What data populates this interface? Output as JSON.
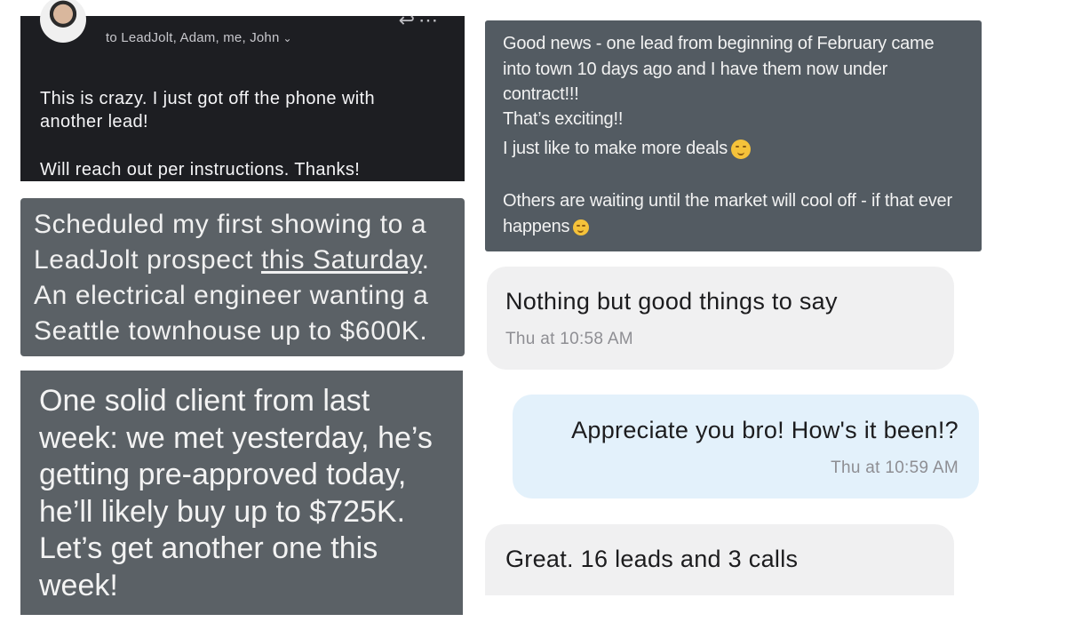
{
  "email": {
    "recipients": "to LeadJolt, Adam, me, John",
    "line1": "This is crazy. I just got off the phone with",
    "line2": "another lead!",
    "line3": "Will reach out per instructions. Thanks!"
  },
  "showing": {
    "line1": "Scheduled my first showing to a",
    "line2_pre": "LeadJolt prospect ",
    "line2_link": "this Saturday",
    "line2_post": ".",
    "line3": "An electrical engineer wanting a",
    "line4": "Seattle townhouse up to $600K."
  },
  "client": {
    "line1": "One solid client from last",
    "line2": "week: we met yesterday, he’s",
    "line3": "getting pre-approved today,",
    "line4": "he’ll likely buy up to $725K.",
    "line5": "Let’s get another one this",
    "line6": "week!"
  },
  "news": {
    "line1": "Good news - one lead from beginning of February came",
    "line2": "into town 10 days ago and I have them now under",
    "line3": "contract!!!",
    "line4": "That’s exciting!!",
    "line5": "I just like to make more deals",
    "line6": "Others are waiting until the market will cool off - if that ever",
    "line7": "happens"
  },
  "chat": {
    "good_msg": "Nothing but good things to say",
    "good_time": "Thu at 10:58 AM",
    "appreciate_msg": "Appreciate you bro! How's it been!?",
    "appreciate_time": "Thu at 10:59 AM",
    "great_msg": "Great. 16 leads and 3 calls"
  },
  "colors": {
    "email_bg": "#1d1e22",
    "grey_bubble": "#5b6166",
    "news_bg": "#535b62",
    "incoming_bubble": "#f0f0f1",
    "outgoing_bubble": "#e3f1fb"
  }
}
